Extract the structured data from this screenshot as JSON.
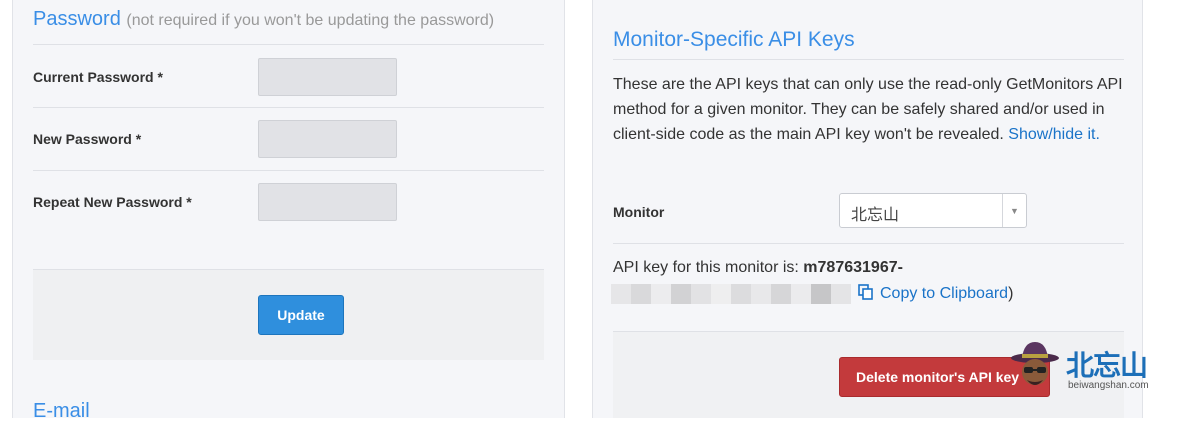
{
  "password_section": {
    "title": "Password",
    "subtitle": "(not required if you won't be updating the password)",
    "fields": [
      {
        "label": "Current Password *",
        "value": ""
      },
      {
        "label": "New Password *",
        "value": ""
      },
      {
        "label": "Repeat New Password *",
        "value": ""
      }
    ],
    "update_button": "Update"
  },
  "email_section": {
    "title": "E-mail"
  },
  "api_section": {
    "title": "Monitor-Specific API Keys",
    "description": "These are the API keys that can only use the read-only GetMonitors API method for a given monitor. They can be safely shared and/or used in client-side code as the main API key won't be revealed.",
    "show_hide_link": "Show/hide it.",
    "monitor_label": "Monitor",
    "monitor_selected": "北忘山",
    "api_key_prefix_label": "API key for this monitor is:",
    "api_key_visible": "m787631967-",
    "copy_link": "Copy to Clipboard",
    "copy_closing": ")",
    "delete_button": "Delete monitor's API key"
  },
  "watermark": {
    "text": "北忘山",
    "sub": "beiwangshan.com",
    "color": "#1c6fb8"
  },
  "icons": {
    "copy": "copy-icon",
    "select_caret": "chevron-down-icon",
    "watermark_logo": "hat-face-logo-icon"
  }
}
